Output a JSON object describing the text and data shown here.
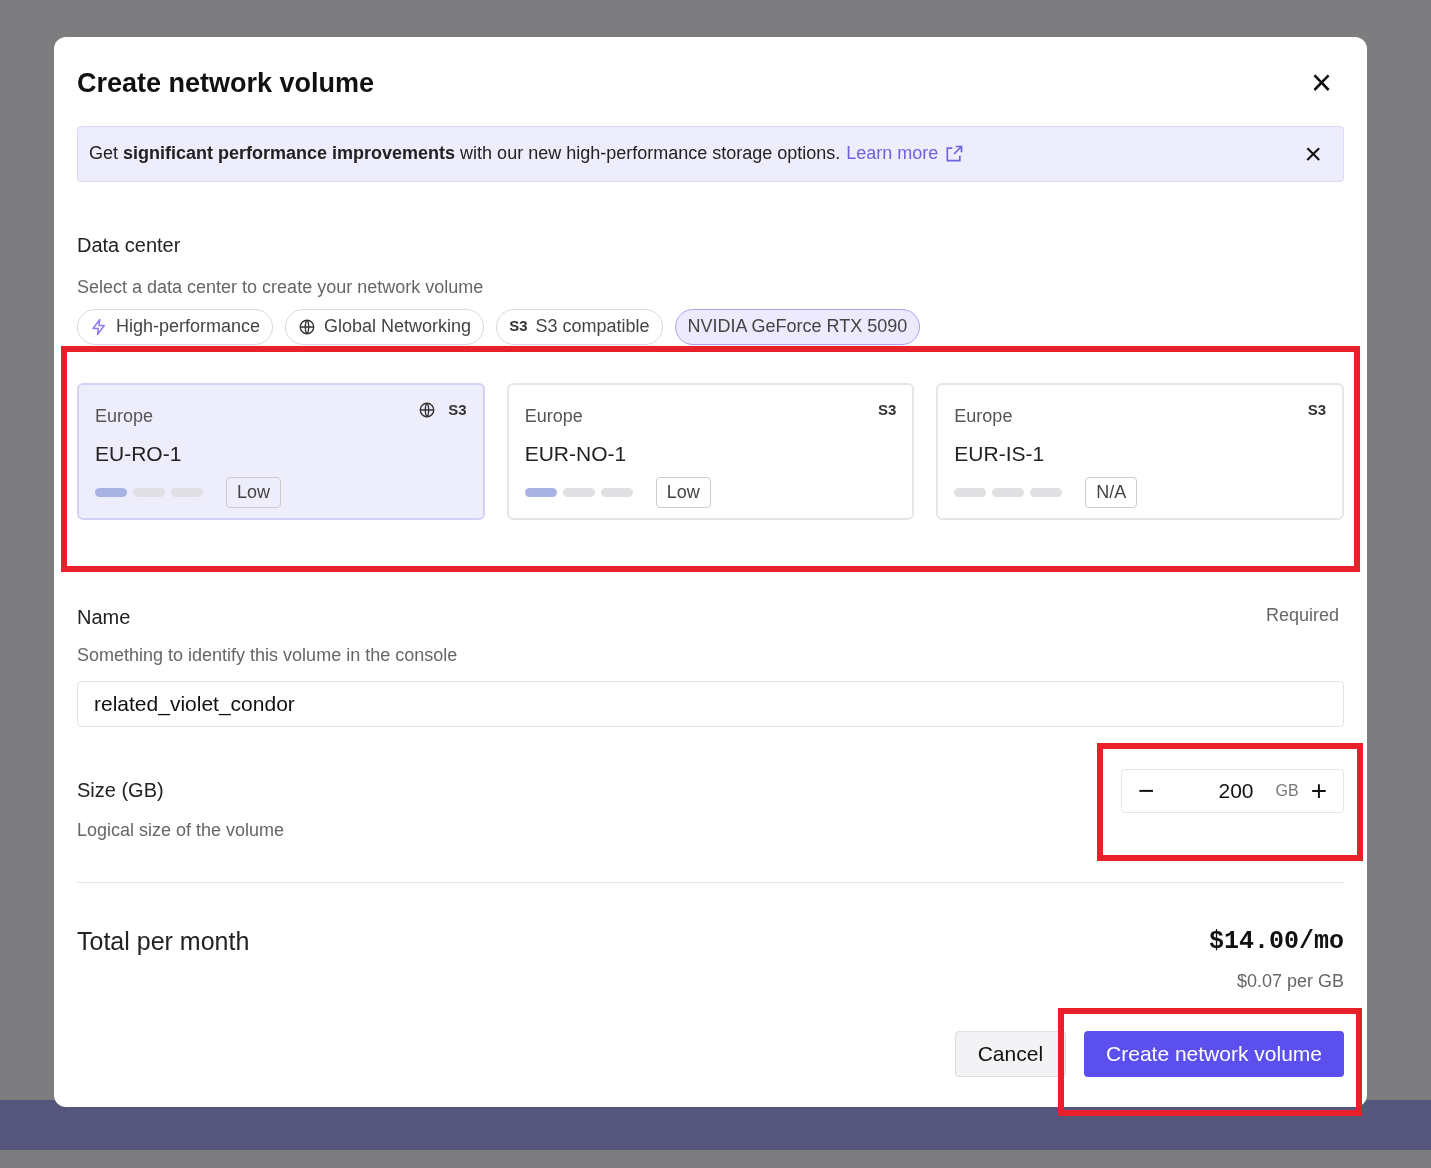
{
  "dialog": {
    "title": "Create network volume",
    "close_label": "×"
  },
  "banner": {
    "text": "Get **significant performance improvements** with our new high-performance storage options.",
    "link": "Learn more",
    "dismiss": "×"
  },
  "data_center": {
    "label": "Data center",
    "description": "Select a data center to create your network volume",
    "filters": [
      {
        "kind": "bolt",
        "label": "High-performance",
        "selected": false
      },
      {
        "kind": "globe",
        "label": "Global Networking",
        "selected": false
      },
      {
        "kind": "text",
        "icon_text": "S3",
        "label": "S3 compatible",
        "selected": false
      },
      {
        "kind": "plain",
        "label": "NVIDIA GeForce RTX 5090",
        "selected": true
      }
    ],
    "options": [
      {
        "region": "Europe",
        "name": "EU-RO-1",
        "global": true,
        "tag": "S3",
        "stars": 1,
        "availability": "Low",
        "selected": true
      },
      {
        "region": "Europe",
        "name": "EUR-NO-1",
        "global": false,
        "tag": "S3",
        "stars": 1,
        "availability": "Low",
        "selected": false
      },
      {
        "region": "Europe",
        "name": "EUR-IS-1",
        "global": false,
        "tag": "S3",
        "stars": 0,
        "availability": "N/A",
        "selected": false
      }
    ]
  },
  "name_field": {
    "label": "Name",
    "required": "Required",
    "description": "Something to identify this volume in the console",
    "value": "related_violet_condor"
  },
  "size_field": {
    "label": "Size (GB)",
    "description": "Logical size of the volume",
    "decrement": "−",
    "value": "200",
    "unit": "GB",
    "increment": "+"
  },
  "total": {
    "label": "Total per month",
    "price": "$14.00/mo",
    "rate": "$0.07 per GB"
  },
  "buttons": [
    {
      "kind": "secondary",
      "label": "Cancel"
    },
    {
      "kind": "primary",
      "label": "Create network volume"
    }
  ]
}
